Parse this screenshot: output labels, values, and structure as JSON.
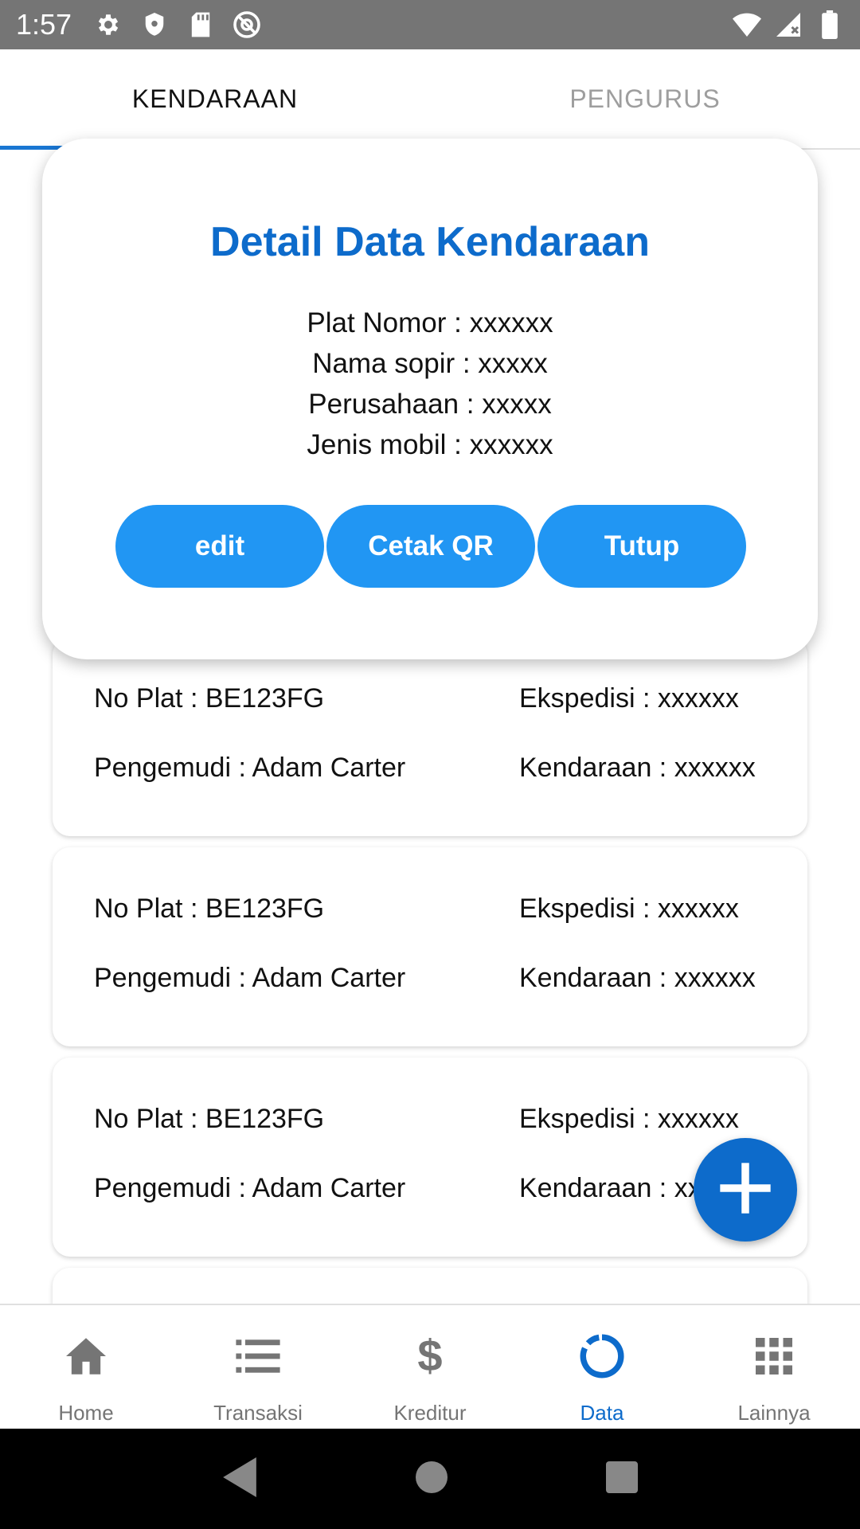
{
  "status_bar": {
    "time": "1:57",
    "left_icons": [
      "gear-icon",
      "shield-icon",
      "sd-card-icon",
      "at-sign-icon"
    ],
    "right_icons": [
      "wifi-icon",
      "signal-icon",
      "battery-icon"
    ]
  },
  "tabs": [
    {
      "label": "KENDARAAN",
      "active": true
    },
    {
      "label": "PENGURUS",
      "active": false
    }
  ],
  "dialog": {
    "title": "Detail Data Kendaraan",
    "lines": [
      "Plat Nomor : xxxxxx",
      "Nama sopir : xxxxx",
      "Perusahaan : xxxxx",
      "Jenis mobil : xxxxxx"
    ],
    "buttons": {
      "edit": "edit",
      "print_qr": "Cetak QR",
      "close": "Tutup"
    }
  },
  "list": {
    "items": [
      {
        "plat": "No Plat : BE123FG",
        "ekspedisi": "Ekspedisi : xxxxxx",
        "pengemudi": "Pengemudi : Adam Carter",
        "kendaraan": "Kendaraan : xxxxxx"
      },
      {
        "plat": "No Plat : BE123FG",
        "ekspedisi": "Ekspedisi : xxxxxx",
        "pengemudi": "Pengemudi : Adam Carter",
        "kendaraan": "Kendaraan : xxxxxx"
      },
      {
        "plat": "No Plat : BE123FG",
        "ekspedisi": "Ekspedisi : xxxxxx",
        "pengemudi": "Pengemudi : Adam Carter",
        "kendaraan": "Kendaraan : xxxxxx"
      },
      {
        "plat": "",
        "ekspedisi": "",
        "pengemudi": "",
        "kendaraan": ""
      }
    ]
  },
  "fab": {
    "icon": "plus-icon"
  },
  "bottom_nav": [
    {
      "label": "Home",
      "icon": "home-icon",
      "active": false
    },
    {
      "label": "Transaksi",
      "icon": "list-icon",
      "active": false
    },
    {
      "label": "Kreditur",
      "icon": "dollar-icon",
      "active": false
    },
    {
      "label": "Data",
      "icon": "data-ring-icon",
      "active": true
    },
    {
      "label": "Lainnya",
      "icon": "grid-icon",
      "active": false
    }
  ],
  "system_nav": {
    "icons": [
      "back-icon",
      "home-circle-icon",
      "recents-icon"
    ]
  },
  "colors": {
    "accent": "#0d6bcb",
    "button": "#2196f3",
    "status_bar": "#757575"
  }
}
